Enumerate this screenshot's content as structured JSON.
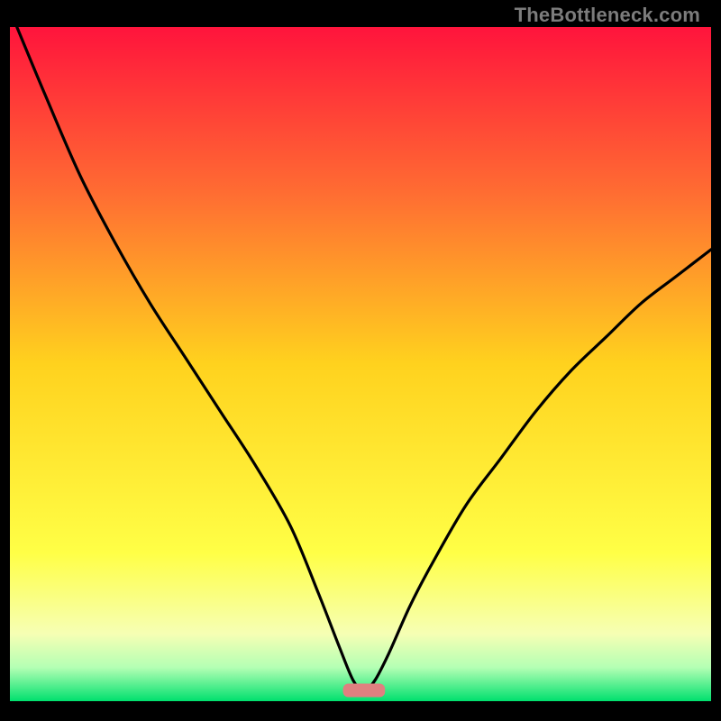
{
  "attribution": "TheBottleneck.com",
  "chart_data": {
    "type": "line",
    "title": "",
    "xlabel": "",
    "ylabel": "",
    "xlim": [
      0,
      100
    ],
    "ylim": [
      0,
      100
    ],
    "gradient_stops": [
      {
        "offset": 0,
        "color": "#ff143c"
      },
      {
        "offset": 25,
        "color": "#ff6e32"
      },
      {
        "offset": 50,
        "color": "#ffd21e"
      },
      {
        "offset": 78,
        "color": "#ffff46"
      },
      {
        "offset": 90,
        "color": "#f6ffb4"
      },
      {
        "offset": 95,
        "color": "#b4ffb4"
      },
      {
        "offset": 100,
        "color": "#00e06e"
      }
    ],
    "series": [
      {
        "name": "bottleneck-curve",
        "x": [
          1,
          5,
          10,
          15,
          20,
          25,
          30,
          35,
          40,
          44,
          47,
          49,
          50.5,
          52,
          54,
          57,
          60,
          65,
          70,
          75,
          80,
          85,
          90,
          95,
          100
        ],
        "y": [
          100,
          90,
          78,
          68,
          59,
          51,
          43,
          35,
          26,
          16,
          8,
          3,
          1.6,
          3,
          7,
          14,
          20,
          29,
          36,
          43,
          49,
          54,
          59,
          63,
          67
        ]
      }
    ],
    "marker": {
      "name": "optimal-region",
      "x": 50.5,
      "y": 1.6,
      "w": 6,
      "h": 2,
      "color": "#e08080"
    }
  }
}
